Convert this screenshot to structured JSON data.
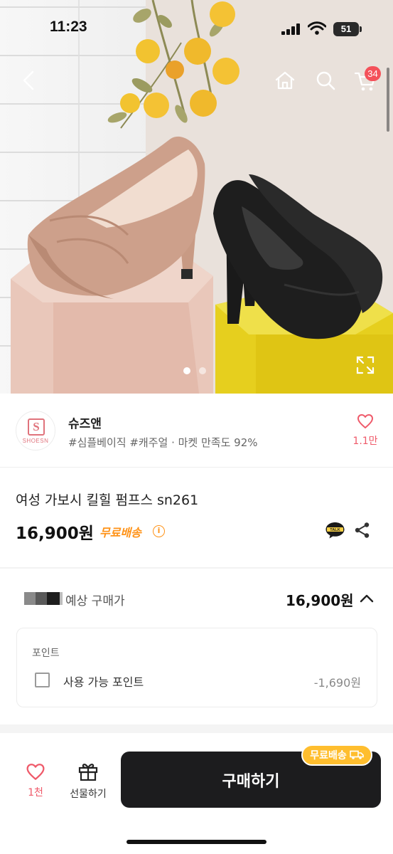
{
  "status_bar": {
    "time": "11:23",
    "battery": "51"
  },
  "header": {
    "cart_count": "34"
  },
  "gallery": {
    "dots": 2,
    "active": 0
  },
  "seller": {
    "logo_letter": "S",
    "logo_text": "SHOESN",
    "name": "슈즈앤",
    "tags": "#심플베이직 #캐주얼 · 마켓 만족도 92%",
    "likes": "1.1만"
  },
  "product": {
    "name": "여성 가보시 킬힐 펌프스 sn261",
    "price": "16,900원",
    "free_shipping": "무료배송",
    "talk_label": "TALK"
  },
  "expected": {
    "label": "예상 구매가",
    "price": "16,900원"
  },
  "points": {
    "title": "포인트",
    "option_label": "사용 가능 포인트",
    "value": "-1,690원"
  },
  "bottom_bar": {
    "like_count": "1천",
    "gift_label": "선물하기",
    "buy_label": "구매하기",
    "ship_tag": "무료배송"
  },
  "colors": {
    "accent_pink": "#ef5a6a",
    "ship_orange": "#ff9318",
    "buy_black": "#1c1c1e",
    "badge_red": "#f4515a"
  }
}
